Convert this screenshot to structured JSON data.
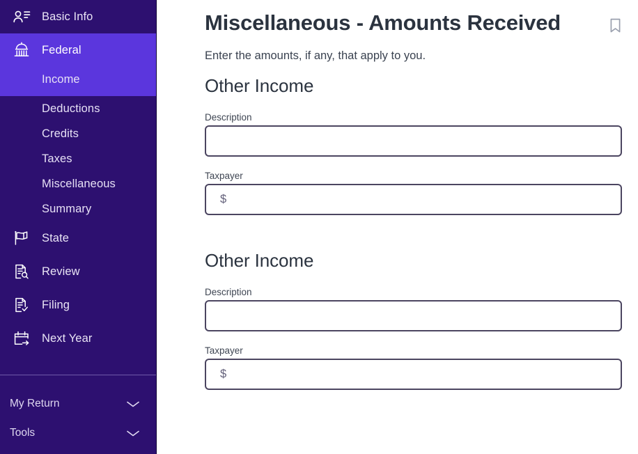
{
  "sidebar": {
    "top_items": [
      {
        "label": "Basic Info",
        "icon": "contact-person-icon"
      }
    ],
    "active_group": {
      "label": "Federal",
      "icon": "capitol-building-icon",
      "sub_items": [
        {
          "label": "Income"
        }
      ]
    },
    "sub_items": [
      {
        "label": "Deductions"
      },
      {
        "label": "Credits"
      },
      {
        "label": "Taxes"
      },
      {
        "label": "Miscellaneous"
      },
      {
        "label": "Summary"
      }
    ],
    "lower_items": [
      {
        "label": "State",
        "icon": "flag-icon"
      },
      {
        "label": "Review",
        "icon": "document-search-icon"
      },
      {
        "label": "Filing",
        "icon": "document-check-icon"
      },
      {
        "label": "Next Year",
        "icon": "calendar-arrow-icon"
      }
    ],
    "bottom_items": [
      {
        "label": "My Return",
        "icon": "chevron-down-icon"
      },
      {
        "label": "Tools",
        "icon": "chevron-down-icon"
      }
    ]
  },
  "main": {
    "title": "Miscellaneous - Amounts Received",
    "bookmark_icon": "bookmark-icon",
    "intro": "Enter the amounts, if any, that apply to you.",
    "sections": [
      {
        "heading": "Other Income",
        "description_label": "Description",
        "description_value": "",
        "description_placeholder": "",
        "taxpayer_label": "Taxpayer",
        "taxpayer_prefix": "$",
        "taxpayer_value": "",
        "taxpayer_placeholder": ""
      },
      {
        "heading": "Other Income",
        "description_label": "Description",
        "description_value": "",
        "description_placeholder": "",
        "taxpayer_label": "Taxpayer",
        "taxpayer_prefix": "$",
        "taxpayer_value": "",
        "taxpayer_placeholder": ""
      }
    ]
  },
  "colors": {
    "sidebar_bg": "#2d1070",
    "sidebar_active": "#5b36dd",
    "title_text": "#2b333f",
    "input_border": "#4b4560",
    "divider": "#6f5aa8"
  }
}
